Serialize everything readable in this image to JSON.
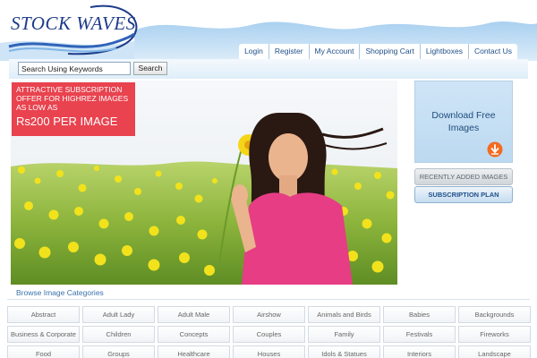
{
  "brand": {
    "logo_text": "STOCK WAVES"
  },
  "nav": {
    "items": [
      "Login",
      "Register",
      "My Account",
      "Shopping Cart",
      "Lightboxes",
      "Contact Us"
    ]
  },
  "search": {
    "placeholder": "Search Using Keywords",
    "button_label": "Search"
  },
  "promo": {
    "line1": "ATTRACTIVE SUBSCRIPTION",
    "line2": "OFFER  FOR HIGHREZ IMAGES",
    "line3": "AS LOW AS",
    "price": "Rs200 PER IMAGE"
  },
  "sidebar": {
    "download_line1": "Download Free",
    "download_line2": "Images",
    "recent_label": "RECENTLY ADDED IMAGES",
    "subscription_label": "SUBSCRIPTION PLAN"
  },
  "categories": {
    "title": "Browse Image Categories",
    "items": [
      "Abstract",
      "Adult Lady",
      "Adult Male",
      "Airshow",
      "Animals and Birds",
      "Babies",
      "Backgrounds",
      "Business & Corporate",
      "Children",
      "Concepts",
      "Couples",
      "Family",
      "Festivals",
      "Fireworks",
      "Food",
      "Groups",
      "Healthcare",
      "Houses",
      "Idols & Statues",
      "Interiors",
      "Landscape"
    ]
  },
  "colors": {
    "accent": "#1f4f8a",
    "promo": "#e8434f",
    "sky": "#bcd9f0"
  }
}
